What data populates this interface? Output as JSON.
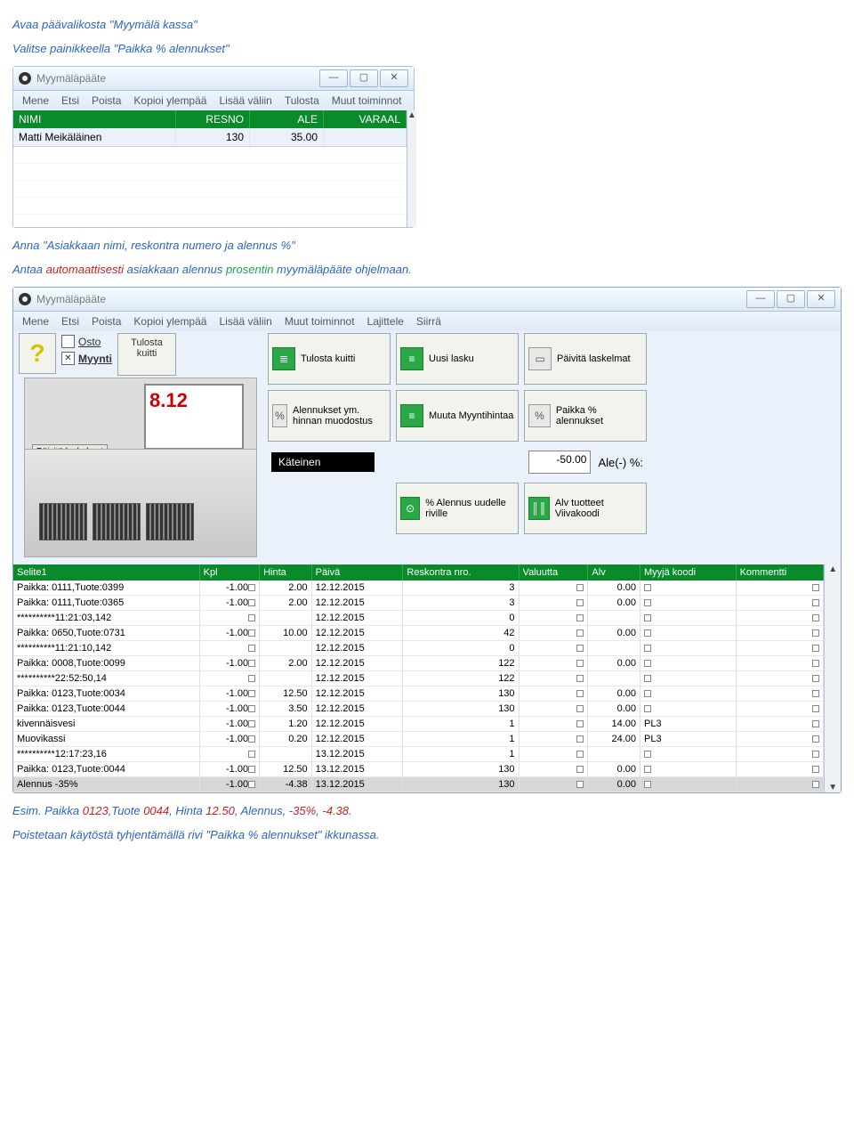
{
  "doc": {
    "line1_a": "Avaa päävalikosta \"",
    "line1_b": "Myymälä kassa",
    "line1_c": "\"",
    "line2_a": "Valitse painikkeella \"",
    "line2_b": "Paikka % alennukset",
    "line2_c": "\"",
    "line3_a": "Anna \"",
    "line3_b": "Asiakkaan nimi, reskontra numero ja alennus %",
    "line3_c": "\"",
    "line4_a": "Antaa ",
    "line4_b": "automaattisesti",
    "line4_c": " asiakkaan alennus ",
    "line4_d": "prosentin",
    "line4_e": " myymäläpääte ohjelmaan.",
    "footer1_a": "Esim. Paikka ",
    "footer1_b": "0123",
    "footer1_c": ",Tuote ",
    "footer1_d": "0044",
    "footer1_e": ", Hinta ",
    "footer1_f": "12.50",
    "footer1_g": ", Alennus, ",
    "footer1_h": "-35%",
    "footer1_i": ", ",
    "footer1_j": "-4.38",
    "footer1_k": ".",
    "footer2_a": "Poistetaan käytöstä tyhjentämällä rivi \"",
    "footer2_b": "Paikka % alennukset",
    "footer2_c": "\" ikkunassa."
  },
  "win1": {
    "title": "Myymäläpääte",
    "menu": [
      "Mene",
      "Etsi",
      "Poista",
      "Kopioi ylempää",
      "Lisää väliin",
      "Tulosta",
      "Muut toiminnot"
    ],
    "hdr": {
      "nimi": "NIMI",
      "resno": "RESNO",
      "ale": "ALE",
      "varaal": "VARAAL"
    },
    "rows": [
      {
        "nimi": "Matti Meikäläinen",
        "resno": "130",
        "ale": "35.00",
        "varaal": ""
      }
    ]
  },
  "main": {
    "title": "Myymäläpääte",
    "menu": [
      "Mene",
      "Etsi",
      "Poista",
      "Kopioi ylempää",
      "Lisää väliin",
      "Muut toiminnot",
      "Lajittele",
      "Siirrä"
    ],
    "osto": "Osto",
    "myynti": "Myynti",
    "tulosta_kuitti": "Tulosta kuitti",
    "screen_value": "8.12",
    "paivita_laskelmat_small": "Päivitä laskelmat",
    "btns": {
      "tulosta_kuitti2": "Tulosta kuitti",
      "uusi_lasku": "Uusi lasku",
      "paivita_laskelmat": "Päivitä laskelmat",
      "alennukset": "Alennukset ym. hinnan muodostus",
      "muuta_myyntihintaa": "Muuta Myyntihintaa",
      "paikka_alennukset": "Paikka % alennukset",
      "prosentti_alennus": "% Alennus uudelle riville",
      "alv_viivakoodi": "Alv tuotteet Viivakoodi"
    },
    "kateinen": "Käteinen",
    "ale_value": "-50.00",
    "ale_label": "Ale(-) %:"
  },
  "table": {
    "cols": [
      "Selite1",
      "Kpl",
      "Hinta",
      "Päivä",
      "Reskontra nro.",
      "Valuutta",
      "Alv",
      "Myyjä koodi",
      "Kommentti"
    ],
    "rows": [
      {
        "s": "Paikka: 0111,Tuote:0399",
        "k": "-1.00",
        "h": "2.00",
        "p": "12.12.2015",
        "r": "3",
        "v": "",
        "a": "0.00",
        "m": "",
        "c": ""
      },
      {
        "s": "Paikka: 0111,Tuote:0365",
        "k": "-1.00",
        "h": "2.00",
        "p": "12.12.2015",
        "r": "3",
        "v": "",
        "a": "0.00",
        "m": "",
        "c": ""
      },
      {
        "s": "**********11:21:03,142",
        "k": "",
        "h": "",
        "p": "12.12.2015",
        "r": "0",
        "v": "",
        "a": "",
        "m": "",
        "c": ""
      },
      {
        "s": "Paikka: 0650,Tuote:0731",
        "k": "-1.00",
        "h": "10.00",
        "p": "12.12.2015",
        "r": "42",
        "v": "",
        "a": "0.00",
        "m": "",
        "c": ""
      },
      {
        "s": "**********11:21:10,142",
        "k": "",
        "h": "",
        "p": "12.12.2015",
        "r": "0",
        "v": "",
        "a": "",
        "m": "",
        "c": ""
      },
      {
        "s": "Paikka: 0008,Tuote:0099",
        "k": "-1.00",
        "h": "2.00",
        "p": "12.12.2015",
        "r": "122",
        "v": "",
        "a": "0.00",
        "m": "",
        "c": ""
      },
      {
        "s": "**********22:52:50,14",
        "k": "",
        "h": "",
        "p": "12.12.2015",
        "r": "122",
        "v": "",
        "a": "",
        "m": "",
        "c": ""
      },
      {
        "s": "Paikka: 0123,Tuote:0034",
        "k": "-1.00",
        "h": "12.50",
        "p": "12.12.2015",
        "r": "130",
        "v": "",
        "a": "0.00",
        "m": "",
        "c": ""
      },
      {
        "s": "Paikka: 0123,Tuote:0044",
        "k": "-1.00",
        "h": "3.50",
        "p": "12.12.2015",
        "r": "130",
        "v": "",
        "a": "0.00",
        "m": "",
        "c": ""
      },
      {
        "s": "kivennäisvesi",
        "k": "-1.00",
        "h": "1.20",
        "p": "12.12.2015",
        "r": "1",
        "v": "",
        "a": "14.00",
        "m": "PL3",
        "c": ""
      },
      {
        "s": "Muovikassi",
        "k": "-1.00",
        "h": "0.20",
        "p": "12.12.2015",
        "r": "1",
        "v": "",
        "a": "24.00",
        "m": "PL3",
        "c": ""
      },
      {
        "s": "**********12:17:23,16",
        "k": "",
        "h": "",
        "p": "13.12.2015",
        "r": "1",
        "v": "",
        "a": "",
        "m": "",
        "c": ""
      },
      {
        "s": "Paikka: 0123,Tuote:0044",
        "k": "-1.00",
        "h": "12.50",
        "p": "13.12.2015",
        "r": "130",
        "v": "",
        "a": "0.00",
        "m": "",
        "c": ""
      },
      {
        "s": "Alennus -35%",
        "k": "-1.00",
        "h": "-4.38",
        "p": "13.12.2015",
        "r": "130",
        "v": "",
        "a": "0.00",
        "m": "",
        "c": "",
        "sel": true
      }
    ]
  }
}
